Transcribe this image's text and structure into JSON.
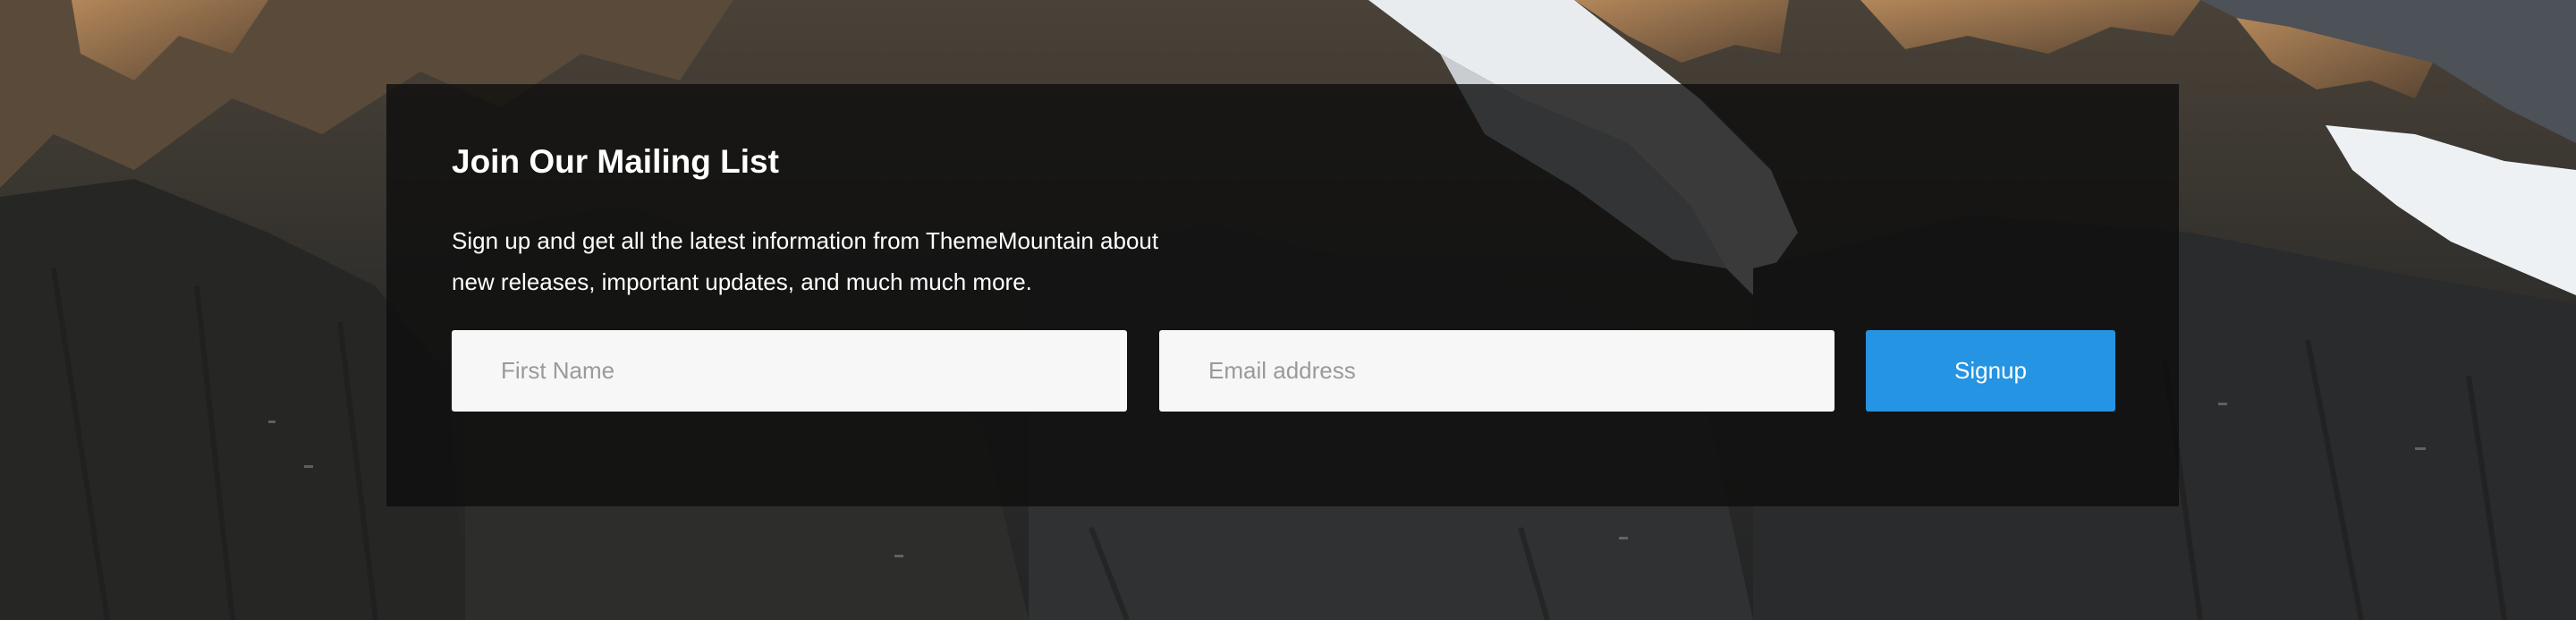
{
  "mailing_list": {
    "title": "Join Our Mailing List",
    "description": "Sign up and get all the latest information from ThemeMountain about new releases, important updates, and much much more.",
    "first_name_placeholder": "First Name",
    "first_name_value": "",
    "email_placeholder": "Email address",
    "email_value": "",
    "signup_label": "Signup"
  },
  "colors": {
    "panel_background": "#0e0e0e",
    "input_background": "#f7f7f7",
    "placeholder_text": "#9a9a9a",
    "button_background": "#2594e2",
    "text": "#ffffff"
  }
}
